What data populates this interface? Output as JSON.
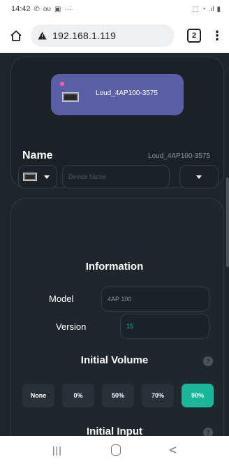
{
  "status_bar": {
    "time": "14:42",
    "left_icons": [
      "whatsapp-icon",
      "notification-icon",
      "image-icon",
      "more-icon"
    ],
    "left_glyphs": [
      "✆",
      "ᴏᴜ",
      "▣",
      "···"
    ],
    "right_icons": [
      "vibrate-icon",
      "wifi-icon",
      "signal-icon",
      "battery-icon"
    ],
    "right_glyphs": [
      "⬚",
      "◔",
      ".ıl",
      "▮"
    ]
  },
  "browser": {
    "url": "192.168.1.119",
    "tab_count": "2"
  },
  "device": {
    "name": "Loud_4AP100-3575",
    "dot_color": "#ff5fa8",
    "card_color": "#5a5fa5"
  },
  "name_section": {
    "title": "Name",
    "current_value": "Loud_4AP100-3575",
    "placeholder": "Device Name"
  },
  "information": {
    "title": "Information",
    "model_label": "Model",
    "model_value": "4AP 100",
    "version_label": "Version",
    "version_value": "15"
  },
  "initial_volume": {
    "title": "Initial Volume",
    "help": "?",
    "options": [
      "None",
      "0%",
      "50%",
      "70%",
      "90%"
    ],
    "selected": "90%",
    "accent_color": "#18b79a"
  },
  "initial_input": {
    "title": "Initial Input",
    "help": "?"
  },
  "nav_bar": {
    "recent_glyph": "|||",
    "back_glyph": "<"
  }
}
